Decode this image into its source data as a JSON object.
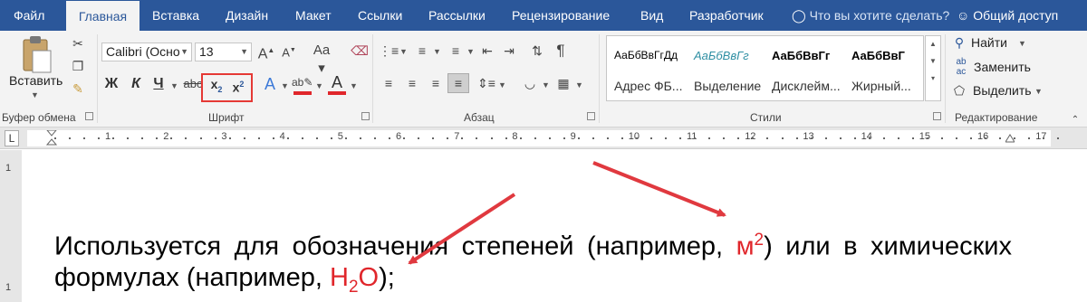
{
  "tabs": [
    "Файл",
    "Главная",
    "Вставка",
    "Дизайн",
    "Макет",
    "Ссылки",
    "Рассылки",
    "Рецензирование",
    "Вид",
    "Разработчик"
  ],
  "tell_me": "Что вы хотите сделать?",
  "share": "Общий доступ",
  "clipboard": {
    "paste": "Вставить",
    "label": "Буфер обмена"
  },
  "font": {
    "name": "Calibri (Осно",
    "size": "13",
    "bold": "Ж",
    "italic": "К",
    "underline": "Ч",
    "strike": "abc",
    "label": "Шрифт"
  },
  "paragraph": {
    "label": "Абзац"
  },
  "styles": {
    "items": [
      {
        "sample": "АаБбВвГгДд",
        "name": "Адрес ФБ..."
      },
      {
        "sample": "АаБбВвГг",
        "name": "Выделение"
      },
      {
        "sample": "АаБбВвГг",
        "name": "Дисклейм..."
      },
      {
        "sample": "АаБбВвГ",
        "name": "Жирный..."
      }
    ],
    "label": "Стили"
  },
  "editing": {
    "find": "Найти",
    "replace": "Заменить",
    "select": "Выделить",
    "label": "Редактирование"
  },
  "ruler": {
    "marks": [
      "1",
      "2",
      "3",
      "4",
      "5",
      "6",
      "7",
      "8",
      "9",
      "10",
      "11",
      "12",
      "13",
      "14",
      "15",
      "16",
      "17"
    ]
  },
  "document": {
    "line1_text": "Используется для обозначения степеней (например, ",
    "m": "м",
    "sup": "2",
    "line1_end": ") или в химических",
    "line2_text": "формулах (например, ",
    "h": "H",
    "sub": "2",
    "o": "O",
    "line2_end": ");"
  },
  "colors": {
    "accent": "#2b579a",
    "highlight": "#e53935",
    "text_red": "#e0262b"
  }
}
